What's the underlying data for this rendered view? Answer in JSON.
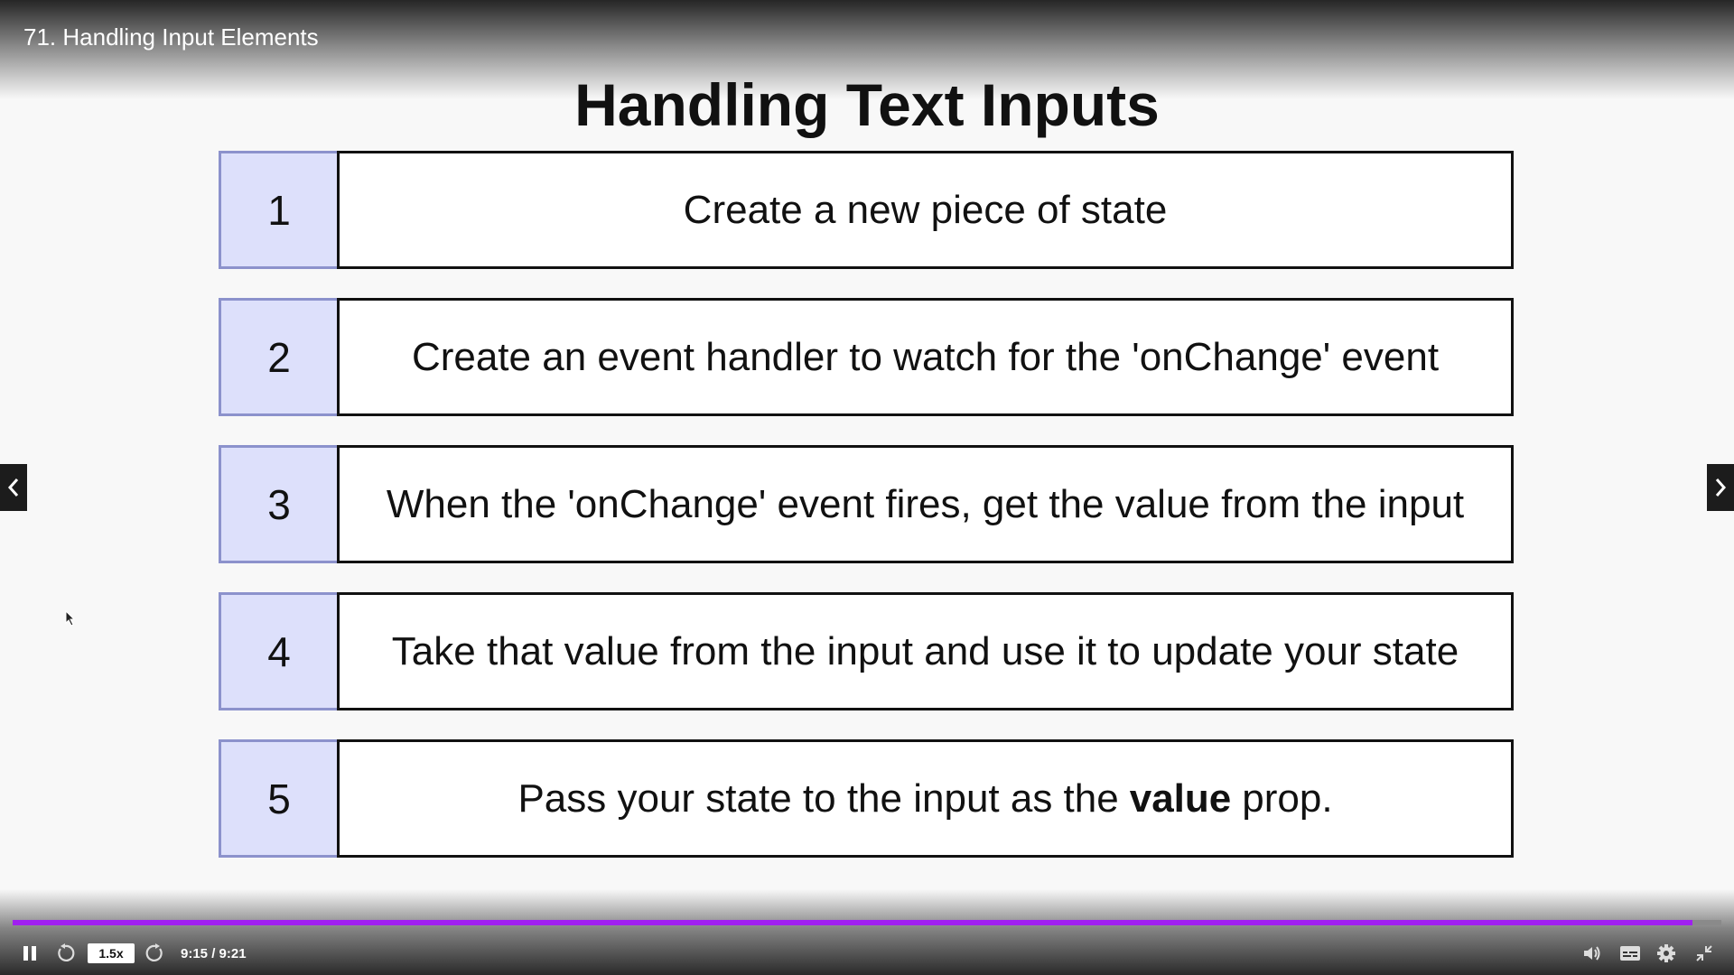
{
  "lecture": {
    "title": "71. Handling Input Elements"
  },
  "slide": {
    "title": "Handling Text Inputs",
    "steps": [
      {
        "num": "1",
        "text": "Create a new piece of state"
      },
      {
        "num": "2",
        "text": "Create an event handler to watch for the 'onChange' event"
      },
      {
        "num": "3",
        "text": "When the 'onChange' event fires, get the value from the input"
      },
      {
        "num": "4",
        "text": "Take that value from the input and use it to update your state"
      },
      {
        "num": "5",
        "text_before": "Pass your state to the input as the",
        "text_bold": "value",
        "text_after": "prop."
      }
    ]
  },
  "player": {
    "speed": "1.5x",
    "time": "9:15 / 9:21",
    "progress": 0.983,
    "accent_color": "#a020f0",
    "icons": [
      "pause-icon",
      "rewind-icon",
      "forward-icon",
      "volume-icon",
      "captions-icon",
      "settings-icon",
      "exit-fullscreen-icon",
      "chevron-left-icon",
      "chevron-right-icon"
    ]
  }
}
